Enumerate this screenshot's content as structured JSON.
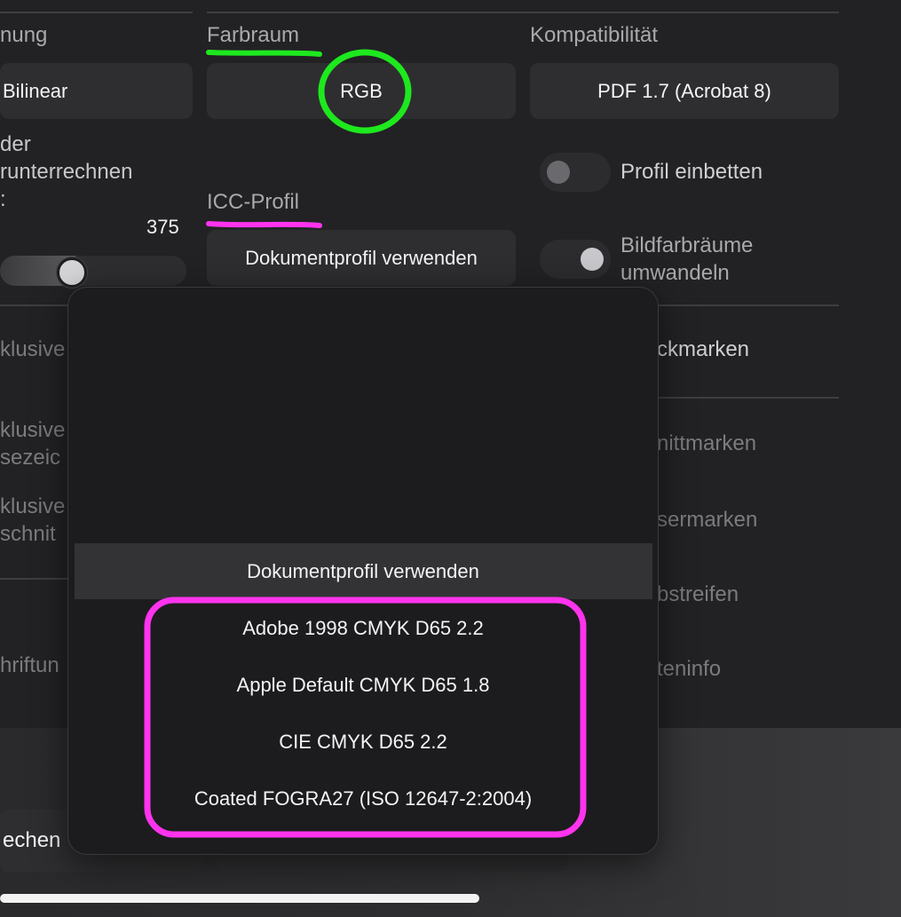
{
  "left_column": {
    "label_partial": "nung",
    "interpolation_value": "Bilinear",
    "downsample_line1": "der",
    "downsample_line2": "runterrechnen",
    "downsample_line3": ":",
    "dpi_value": "375",
    "slider_fraction": 0.38,
    "partial_1": "klusive",
    "partial_2a": "klusive",
    "partial_2b": "sezeic",
    "partial_3a": "klusive",
    "partial_3b": "schnit",
    "partial_4": "hriftun",
    "partial_5": "echen"
  },
  "middle_column": {
    "color_space_label": "Farbraum",
    "color_space_value": "RGB",
    "icc_label": "ICC-Profil",
    "icc_value": "Dokumentprofil verwenden"
  },
  "right_column": {
    "compat_label": "Kompatibilität",
    "compat_value": "PDF 1.7 (Acrobat 8)",
    "embed_profile_label": "Profil einbetten",
    "embed_profile_on": false,
    "convert_line1": "Bildfarbräume",
    "convert_line2": "umwandeln",
    "convert_on": true,
    "partial_1": "ckmarken",
    "partial_2": "nittmarken",
    "partial_3": "sermarken",
    "partial_4": "bstreifen",
    "partial_5": "teninfo"
  },
  "popover": {
    "selected": "Dokumentprofil verwenden",
    "options": [
      "Adobe 1998 CMYK D65 2.2",
      "Apple Default CMYK D65 1.8",
      "CIE CMYK D65 2.2",
      "Coated FOGRA27 (ISO 12647-2:2004)"
    ]
  },
  "colors": {
    "annotation_green": "#1ee81e",
    "annotation_magenta": "#ff33ee"
  }
}
